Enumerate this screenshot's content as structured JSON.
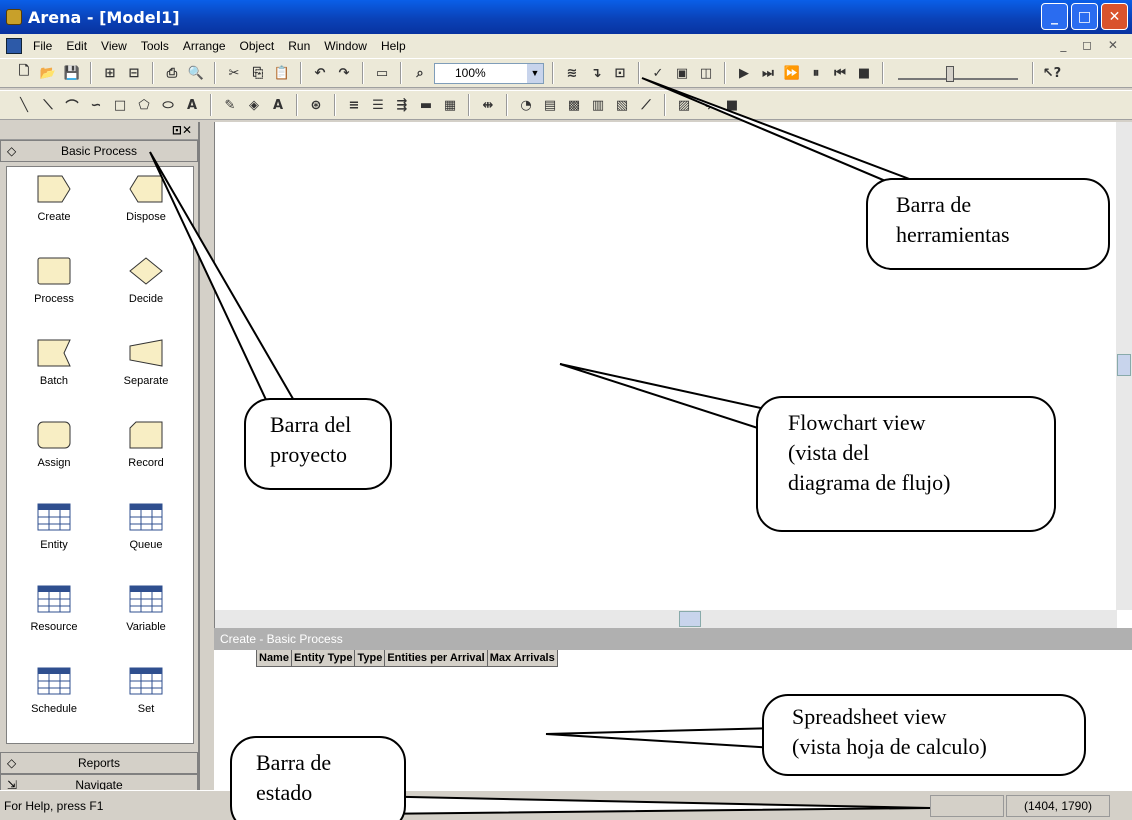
{
  "window": {
    "title": "Arena - [Model1]"
  },
  "menu": {
    "items": [
      "File",
      "Edit",
      "View",
      "Tools",
      "Arrange",
      "Object",
      "Run",
      "Window",
      "Help"
    ]
  },
  "toolbar": {
    "zoom": "100%"
  },
  "project": {
    "panel_title": "Basic Process",
    "modules": [
      "Create",
      "Dispose",
      "Process",
      "Decide",
      "Batch",
      "Separate",
      "Assign",
      "Record",
      "Entity",
      "Queue",
      "Resource",
      "Variable",
      "Schedule",
      "Set"
    ],
    "reports": "Reports",
    "navigate": "Navigate"
  },
  "spreadsheet": {
    "title": "Create - Basic Process",
    "columns": [
      "Name",
      "Entity Type",
      "Type",
      "Entities per Arrival",
      "Max Arrivals"
    ]
  },
  "status": {
    "help": "For Help, press F1",
    "coords": "(1404, 1790)"
  },
  "callouts": {
    "toolbar_l1": "Barra de",
    "toolbar_l2": "herramientas",
    "project_l1": "Barra del",
    "project_l2": "proyecto",
    "flow_l1": "Flowchart view",
    "flow_l2": "(vista del",
    "flow_l3": "diagrama de flujo)",
    "sheet_l1": "Spreadsheet view",
    "sheet_l2": "(vista hoja de calculo)",
    "status_l1": "Barra de",
    "status_l2": "estado"
  },
  "colors": {
    "titlebar": "#0a42b8",
    "module_fill": "#f8eec4",
    "table_header": "#2f4f8f"
  }
}
